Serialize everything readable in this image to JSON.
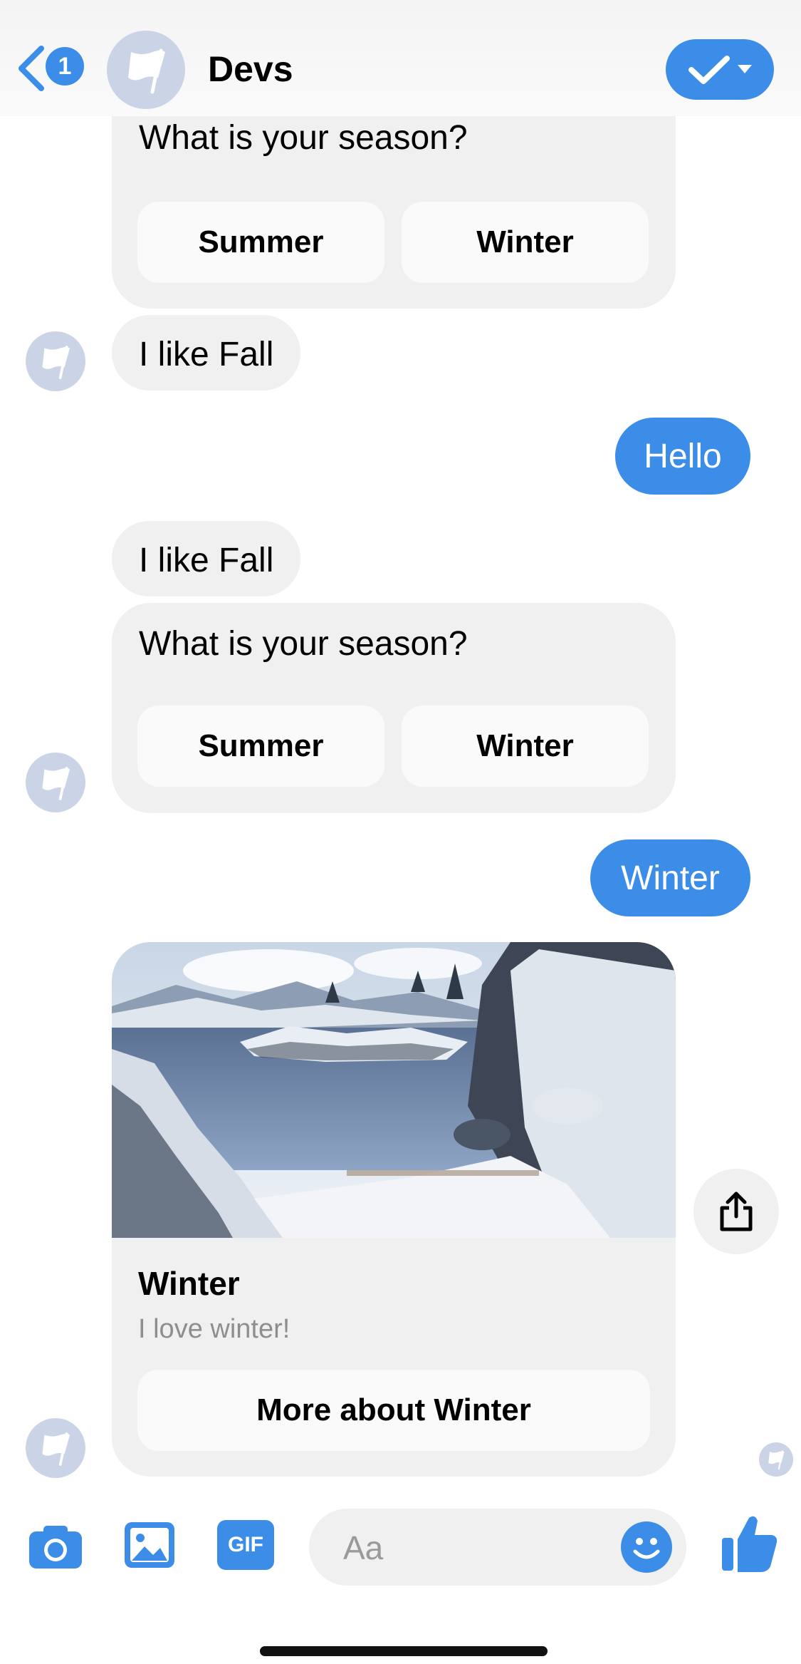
{
  "header": {
    "unread_count": "1",
    "title": "Devs"
  },
  "messages": {
    "quick_reply_1": {
      "question": "What is your season?",
      "options": [
        "Summer",
        "Winter"
      ]
    },
    "in_1": "I like Fall",
    "out_1": "Hello",
    "in_2": "I like Fall",
    "quick_reply_2": {
      "question": "What is your season?",
      "options": [
        "Summer",
        "Winter"
      ]
    },
    "out_2": "Winter",
    "card": {
      "title": "Winter",
      "subtitle": "I love winter!",
      "button_label": "More about Winter"
    }
  },
  "composer": {
    "gif_label": "GIF",
    "placeholder": "Aa"
  },
  "colors": {
    "accent": "#3b8de8",
    "bubble_gray": "#f0f0f0",
    "avatar_gray": "#cbd3e6"
  },
  "icons": [
    "chevron-left-icon",
    "flag-icon",
    "check-icon",
    "caret-down-icon",
    "share-icon",
    "camera-icon",
    "image-icon",
    "gif-icon",
    "emoji-icon",
    "thumbs-up-icon"
  ]
}
